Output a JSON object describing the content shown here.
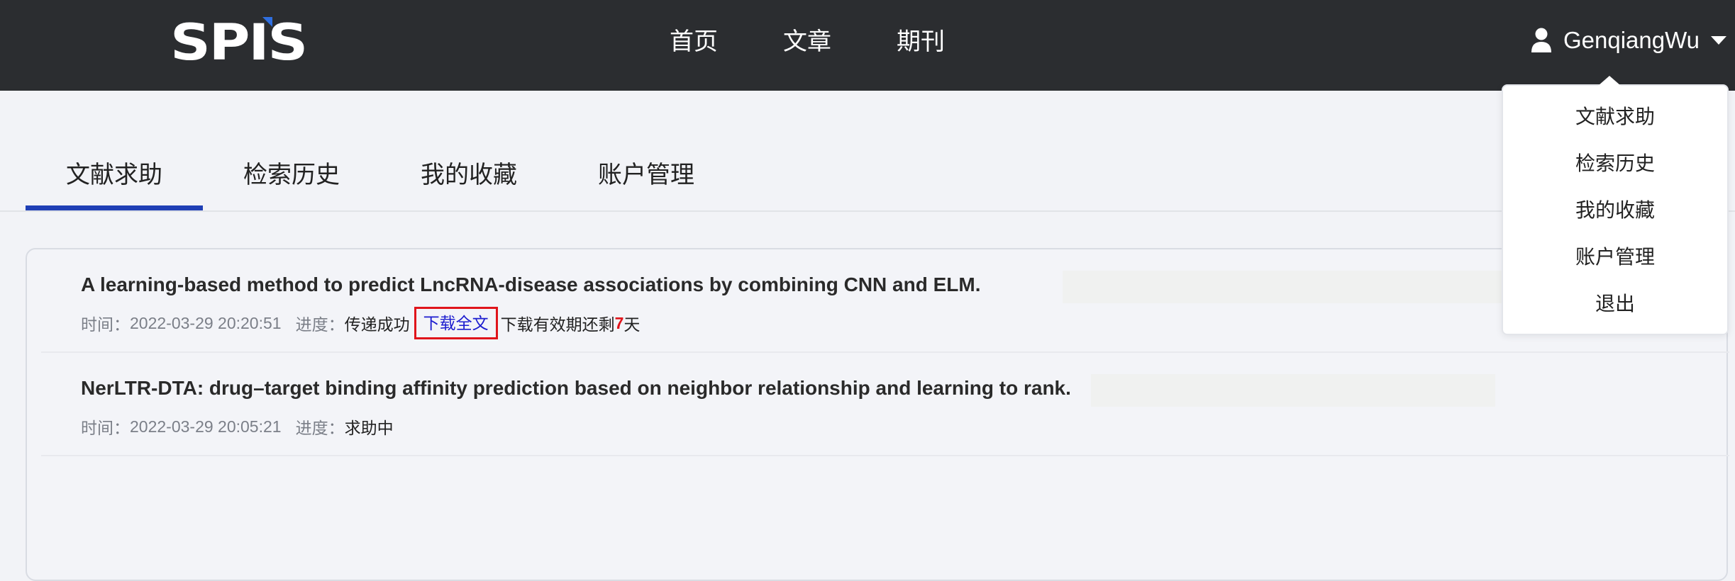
{
  "logo": {
    "text": "SPIS",
    "accent": "#2f6fe0"
  },
  "nav": {
    "links": [
      {
        "label": "首页"
      },
      {
        "label": "文章"
      },
      {
        "label": "期刊"
      }
    ],
    "user": {
      "name": "GenqiangWu",
      "icon": "user-icon",
      "caret": "caret-down-icon"
    }
  },
  "tabs": {
    "items": [
      {
        "label": "文献求助",
        "active": true
      },
      {
        "label": "检索历史",
        "active": false
      },
      {
        "label": "我的收藏",
        "active": false
      },
      {
        "label": "账户管理",
        "active": false
      }
    ],
    "active_color": "#1f3fb5"
  },
  "records": [
    {
      "title": "A learning-based method to predict LncRNA-disease associations by combining CNN and ELM.",
      "time_label": "时间：",
      "time": "2022-03-29 20:20:51",
      "progress_label": "进度：",
      "status": "传递成功",
      "download_label": "下载全文",
      "note_prefix": "下载有效期还剩",
      "days": "7",
      "note_suffix": "天"
    },
    {
      "title": "NerLTR-DTA: drug–target binding affinity prediction based on neighbor relationship and learning to rank.",
      "time_label": "时间：",
      "time": "2022-03-29 20:05:21",
      "progress_label": "进度：",
      "status": "求助中"
    }
  ],
  "dropdown": {
    "items": [
      {
        "label": "文献求助"
      },
      {
        "label": "检索历史"
      },
      {
        "label": "我的收藏"
      },
      {
        "label": "账户管理"
      },
      {
        "label": "退出"
      }
    ]
  },
  "colors": {
    "navbar": "#2b2d30",
    "highlight_border": "#e0141b",
    "link": "#1c1ccf"
  }
}
